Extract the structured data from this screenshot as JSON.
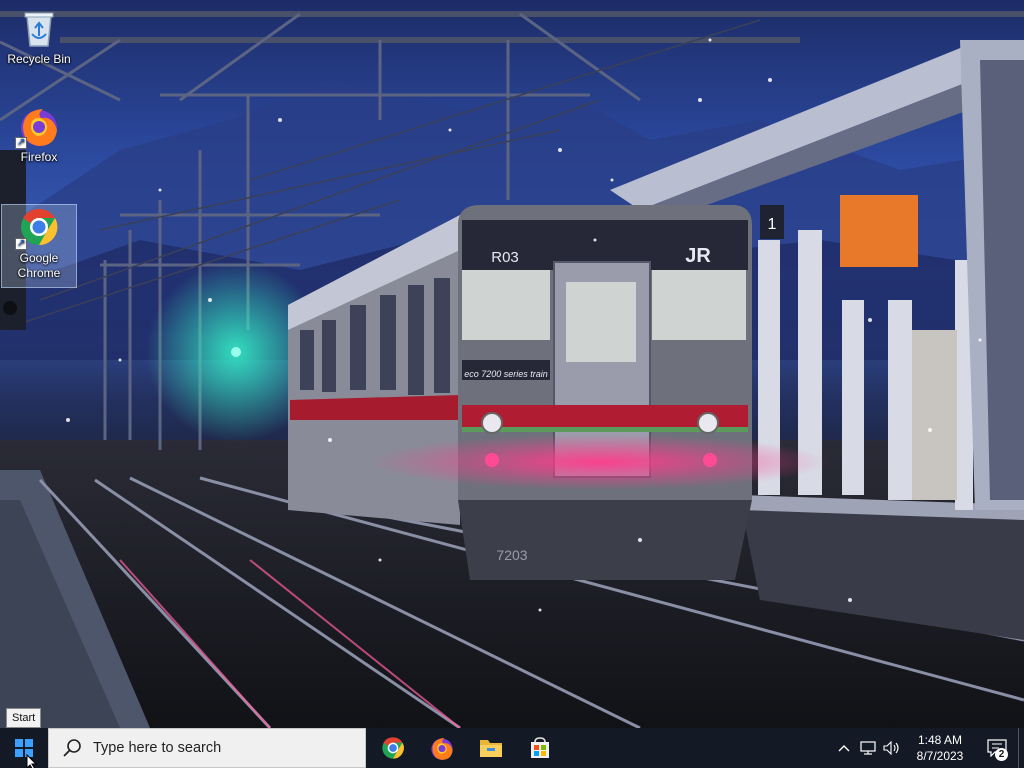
{
  "desktop": {
    "icons": [
      {
        "label": "Recycle Bin",
        "icon": "recycle-bin-icon"
      },
      {
        "label": "Firefox",
        "icon": "firefox-icon"
      },
      {
        "label": "Google Chrome",
        "icon": "chrome-icon"
      }
    ],
    "wallpaper": {
      "train_route": "R03",
      "train_brand": "JR",
      "train_series": "eco 7200 series train",
      "train_number": "7203",
      "platform_sign": "1"
    }
  },
  "tooltip": {
    "text": "Start"
  },
  "taskbar": {
    "start_icon": "windows-logo-icon",
    "search_placeholder": "Type here to search",
    "pinned": [
      {
        "name": "Google Chrome",
        "icon": "chrome-icon"
      },
      {
        "name": "Firefox",
        "icon": "firefox-icon"
      },
      {
        "name": "File Explorer",
        "icon": "folder-icon"
      },
      {
        "name": "Microsoft Store",
        "icon": "store-icon"
      }
    ],
    "tray": {
      "icons": [
        "chevron-up-icon",
        "network-icon",
        "volume-icon"
      ],
      "time": "1:48 AM",
      "date": "8/7/2023",
      "notification_count": "2"
    }
  },
  "colors": {
    "taskbar": "#161a26",
    "search_bg": "#f0f0f0",
    "accent": "#0078d7"
  }
}
